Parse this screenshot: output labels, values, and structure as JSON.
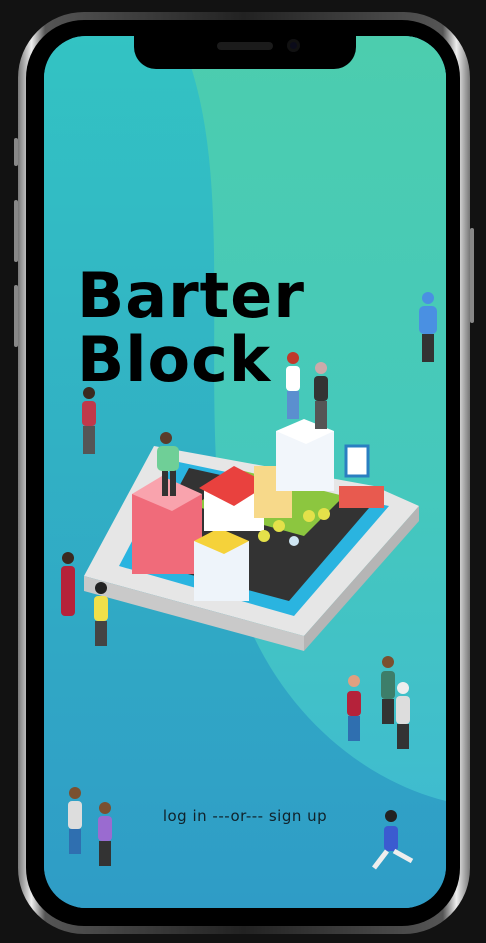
{
  "app": {
    "title_line1": "Barter",
    "title_line2": "Block"
  },
  "auth": {
    "login_label": "log in",
    "separator": "---or---",
    "signup_label": "sign up"
  },
  "colors": {
    "teal": "#31c1c1",
    "green": "#4acdae",
    "blue": "#2f9dc4",
    "text": "#000000"
  }
}
